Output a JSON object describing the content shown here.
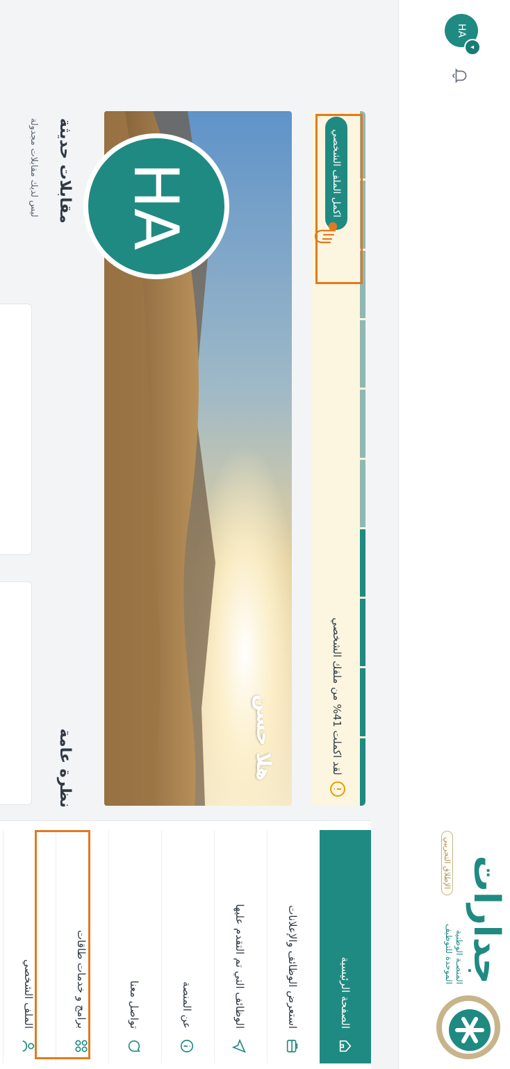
{
  "brand": {
    "name": "جدارات",
    "subtitle_line1": "المنصـة الوطنية",
    "subtitle_line2": "الموحدة للتوظيف",
    "beta_label": "الإطلاق التجريبي",
    "accent": "#1f8a82"
  },
  "user": {
    "initials": "HA",
    "greeting": "هلا حسن"
  },
  "nav": {
    "items": [
      {
        "label": "الصفحة الرئيسية",
        "icon": "home-icon",
        "active": true
      },
      {
        "label": "استعرض الوظائف والإعلانات",
        "icon": "briefcase-icon"
      },
      {
        "label": "الوظائف التي تم التقدم عليها",
        "icon": "send-icon"
      },
      {
        "label": "عن المنصة",
        "icon": "info-icon"
      },
      {
        "label": "تواصل معنا",
        "icon": "chat-icon"
      },
      {
        "label": "برامج و خدمات طاقات",
        "icon": "grid-icon"
      },
      {
        "label": "الملف الشخصي",
        "icon": "user-icon"
      }
    ]
  },
  "profile_progress": {
    "text": "لقد اكملت 41% من ملفك الشخصي",
    "percent": 41,
    "segments_total": 10,
    "segments_filled": 4,
    "button_label": "اكمل الملف الشخصي"
  },
  "overview": {
    "title": "نظرة عامة"
  },
  "interviews": {
    "title": "مقابلات حديثة",
    "empty_text": "ليس لديك مقابلات مجدولة"
  },
  "colors": {
    "highlight": "#e07a1f",
    "warning_bg": "#fcf5df"
  }
}
